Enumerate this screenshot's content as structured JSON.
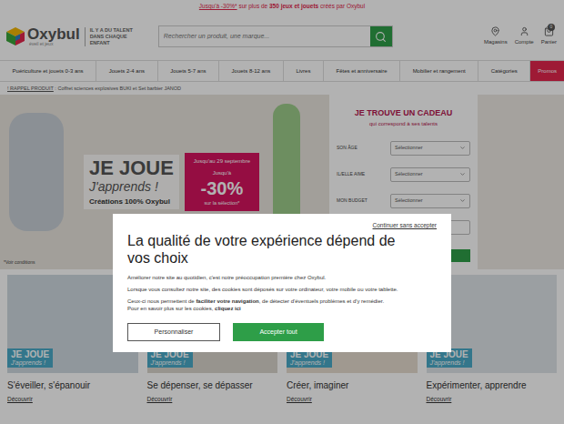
{
  "promo_bar": {
    "segments": [
      {
        "text": "Jusqu'à -30%*",
        "kind": "link"
      },
      {
        "text": " sur plus de ",
        "kind": "plain"
      },
      {
        "text": "350 jeux et jouets",
        "kind": "bold"
      },
      {
        "text": " créés par Oxybul",
        "kind": "plain"
      }
    ]
  },
  "header": {
    "logo": {
      "name": "Oxybul",
      "tagline": "éveil et jeux"
    },
    "slogan": [
      "IL Y A DU TALENT",
      "DANS CHAQUE",
      "ENFANT"
    ],
    "search": {
      "placeholder": "Rechercher un produit, une marque..."
    },
    "links": [
      {
        "label": "Magasins",
        "badge": ""
      },
      {
        "label": "Compte",
        "badge": ""
      },
      {
        "label": "Panier",
        "badge": "0"
      }
    ]
  },
  "nav": [
    {
      "label": "Puériculture et jouets 0-3 ans",
      "kind": "link"
    },
    {
      "label": "Jouets 2-4 ans",
      "kind": "link"
    },
    {
      "label": "Jouets 5-7 ans",
      "kind": "link"
    },
    {
      "label": "Jouets 8-12 ans",
      "kind": "link"
    },
    {
      "label": "Livres",
      "kind": "link"
    },
    {
      "label": "Fêtes et anniversaire",
      "kind": "link"
    },
    {
      "label": "Mobilier et rangement",
      "kind": "link"
    },
    {
      "label": "Catégories",
      "kind": "link"
    },
    {
      "label": "Promos",
      "kind": "promo"
    }
  ],
  "recall": {
    "label": "! RAPPEL PRODUIT",
    "text": " : Coffret sciences explosives BUKI et Set barbier JANOD"
  },
  "hero": {
    "title": "JE JOUE",
    "subtitle": "J'apprends !",
    "tagline": "Créations 100% Oxybul",
    "promo": {
      "date": "Jusqu'au 29 septembre",
      "prefix": "Jusqu'à",
      "value": "-30%",
      "suffix": "sur la sélection*"
    },
    "note": "*Voir conditions"
  },
  "gift_finder": {
    "title": "JE TROUVE UN CADEAU",
    "subtitle": "qui correspond à ses talents",
    "fields": [
      {
        "label": "SON ÂGE",
        "value": "Sélectionner"
      },
      {
        "label": "IL/ELLE AIME",
        "value": "Sélectionner"
      },
      {
        "label": "MON BUDGET",
        "value": "Sélectionner"
      }
    ]
  },
  "cards": [
    {
      "badge_title": "JE JOUE",
      "badge_subtitle": "J'apprends !",
      "title": "S'éveiller, s'épanouir",
      "link": "Découvrir"
    },
    {
      "badge_title": "JE JOUE",
      "badge_subtitle": "J'apprends !",
      "title": "Se dépenser, se dépasser",
      "link": "Découvrir"
    },
    {
      "badge_title": "JE JOUE",
      "badge_subtitle": "J'apprends !",
      "title": "Créer, imaginer",
      "link": "Découvrir"
    },
    {
      "badge_title": "JE JOUE",
      "badge_subtitle": "J'apprends !",
      "title": "Expérimenter, apprendre",
      "link": "Découvrir"
    }
  ],
  "cookie_dialog": {
    "dismiss": "Continuer sans accepter",
    "title": "La qualité de votre expérience dépend de vos choix",
    "paragraphs": [
      [
        {
          "text": "Améliorer notre site au quotidien, c'est notre préoccupation première chez Oxybul.",
          "bold": false
        }
      ],
      [
        {
          "text": "Lorsque vous consultez notre site, des cookies sont déposés sur votre ordinateur, votre mobile ou votre tablette.",
          "bold": false
        }
      ],
      [
        {
          "text": "Ceux-ci nous permettent de ",
          "bold": false
        },
        {
          "text": "faciliter votre navigation",
          "bold": true
        },
        {
          "text": ", de détecter d'éventuels problèmes et d'y remédier.",
          "bold": false
        },
        {
          "text": "\nPour en savoir plus sur les cookies, ",
          "bold": false
        },
        {
          "text": "cliquez ici",
          "bold": true
        }
      ]
    ],
    "buttons": [
      {
        "label": "Personnaliser",
        "kind": "secondary"
      },
      {
        "label": "Accepter tout",
        "kind": "primary"
      }
    ]
  }
}
